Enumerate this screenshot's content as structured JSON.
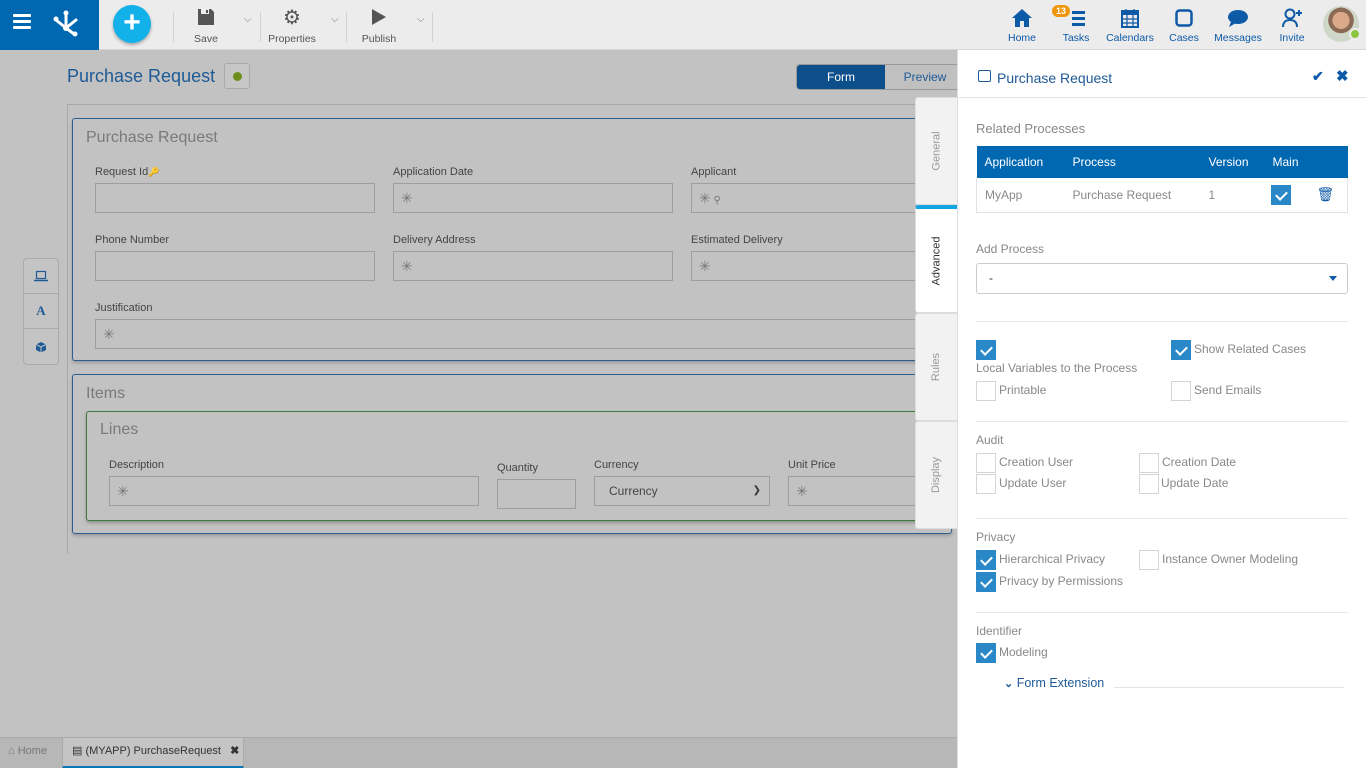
{
  "topbar": {
    "toolbar": [
      {
        "label": "Save",
        "icon": "save-icon"
      },
      {
        "label": "Properties",
        "icon": "gear-icon"
      },
      {
        "label": "Publish",
        "icon": "play-icon"
      }
    ],
    "nav": [
      {
        "label": "Home",
        "icon": "home-icon"
      },
      {
        "label": "Tasks",
        "icon": "tasks-icon",
        "badge": "13"
      },
      {
        "label": "Calendars",
        "icon": "calendar-icon"
      },
      {
        "label": "Cases",
        "icon": "cases-icon"
      },
      {
        "label": "Messages",
        "icon": "messages-icon"
      },
      {
        "label": "Invite",
        "icon": "invite-icon"
      }
    ],
    "colors": {
      "brand": "#0067b1",
      "add": "#12b1ea",
      "badge": "#f0960e",
      "online": "#8dc63f"
    }
  },
  "form": {
    "title": "Purchase Request",
    "view_tabs": [
      "Form",
      "Preview"
    ],
    "active_view": "Form",
    "side_tools": [
      "computer-icon",
      "text-icon",
      "cube-icon"
    ],
    "panel1": {
      "title": "Purchase Request",
      "fields": [
        {
          "label": "Request Id",
          "value": ""
        },
        {
          "label": "Application Date",
          "value": "✳"
        },
        {
          "label": "Applicant",
          "value": "✳"
        },
        {
          "label": "Phone Number",
          "value": ""
        },
        {
          "label": "Delivery Address",
          "value": "✳"
        },
        {
          "label": "Estimated Delivery",
          "value": "✳"
        },
        {
          "label": "Justification",
          "value": "✳"
        }
      ]
    },
    "panel2": {
      "title": "Items",
      "lines": {
        "title": "Lines",
        "fields": [
          {
            "label": "Description",
            "value": "✳"
          },
          {
            "label": "Quantity",
            "value": ""
          },
          {
            "label": "Currency",
            "value": "Currency"
          },
          {
            "label": "Unit Price",
            "value": "✳"
          }
        ]
      }
    }
  },
  "vtabs": [
    "General",
    "Advanced",
    "Rules",
    "Display"
  ],
  "active_vtab": "Advanced",
  "properties": {
    "title": "Purchase Request",
    "related_processes": {
      "label": "Related Processes",
      "columns": [
        "Application",
        "Process",
        "Version",
        "Main"
      ],
      "rows": [
        {
          "application": "MyApp",
          "process": "Purchase Request",
          "version": "1",
          "main": true
        }
      ]
    },
    "add_process": {
      "label": "Add Process",
      "value": "-"
    },
    "options": [
      {
        "label": "Local Variables to the Process",
        "checked": true
      },
      {
        "label": "Show Related Cases",
        "checked": true
      },
      {
        "label": "Printable",
        "checked": false
      },
      {
        "label": "Send Emails",
        "checked": false
      }
    ],
    "audit": {
      "label": "Audit",
      "items": [
        {
          "label": "Creation User",
          "checked": false
        },
        {
          "label": "Creation Date",
          "checked": false
        },
        {
          "label": "Update User",
          "checked": false
        },
        {
          "label": "Update Date",
          "checked": false
        }
      ]
    },
    "privacy": {
      "label": "Privacy",
      "items": [
        {
          "label": "Hierarchical Privacy",
          "checked": true
        },
        {
          "label": "Instance Owner Modeling",
          "checked": false
        },
        {
          "label": "Privacy by Permissions",
          "checked": true
        }
      ]
    },
    "identifier": {
      "label": "Identifier",
      "items": [
        {
          "label": "Modeling",
          "checked": true
        }
      ]
    },
    "form_extension": "Form Extension"
  },
  "bottom_tabs": [
    {
      "label": "Home",
      "active": false
    },
    {
      "label": "(MYAPP) PurchaseRequest",
      "active": true
    }
  ]
}
